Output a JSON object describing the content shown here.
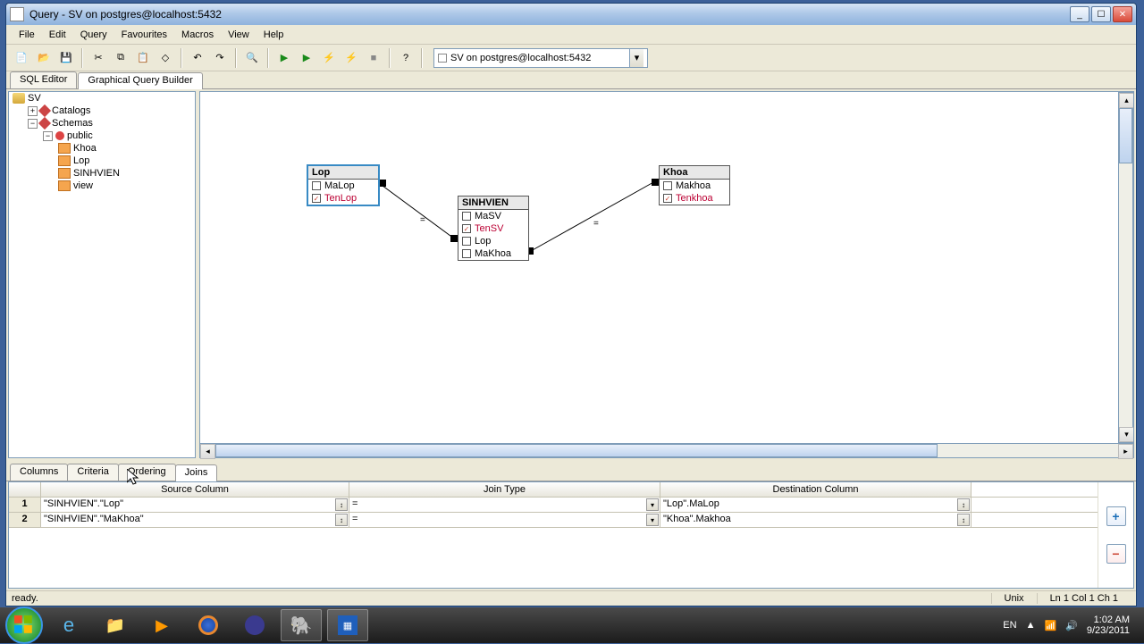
{
  "titlebar": {
    "title": "Query - SV on postgres@localhost:5432"
  },
  "menu": [
    "File",
    "Edit",
    "Query",
    "Favourites",
    "Macros",
    "View",
    "Help"
  ],
  "dbselect": "SV on postgres@localhost:5432",
  "view_tabs": {
    "sql": "SQL Editor",
    "gqb": "Graphical Query Builder"
  },
  "tree": {
    "root": "SV",
    "catalogs": "Catalogs",
    "schemas": "Schemas",
    "public": "public",
    "tables": [
      "Khoa",
      "Lop",
      "SINHVIEN",
      "view"
    ]
  },
  "boxes": {
    "Lop": {
      "title": "Lop",
      "cols": [
        {
          "name": "MaLop",
          "checked": false
        },
        {
          "name": "TenLop",
          "checked": true
        }
      ]
    },
    "SINHVIEN": {
      "title": "SINHVIEN",
      "cols": [
        {
          "name": "MaSV",
          "checked": false
        },
        {
          "name": "TenSV",
          "checked": true
        },
        {
          "name": "Lop",
          "checked": false
        },
        {
          "name": "MaKhoa",
          "checked": false
        }
      ]
    },
    "Khoa": {
      "title": "Khoa",
      "cols": [
        {
          "name": "Makhoa",
          "checked": false
        },
        {
          "name": "Tenkhoa",
          "checked": true
        }
      ]
    }
  },
  "conn_eq": "=",
  "bottom_tabs": {
    "columns": "Columns",
    "criteria": "Criteria",
    "ordering": "Ordering",
    "joins": "Joins"
  },
  "grid": {
    "headers": {
      "src": "Source Column",
      "jt": "Join Type",
      "dst": "Destination Column"
    },
    "rows": [
      {
        "n": "1",
        "src": "\"SINHVIEN\".\"Lop\"",
        "jt": "=",
        "dst": "\"Lop\".MaLop"
      },
      {
        "n": "2",
        "src": "\"SINHVIEN\".\"MaKhoa\"",
        "jt": "=",
        "dst": "\"Khoa\".Makhoa"
      }
    ]
  },
  "statusbar": {
    "left": "ready.",
    "unix": "Unix",
    "pos": "Ln 1 Col 1 Ch 1"
  },
  "tray": {
    "lang": "EN",
    "time": "1:02 AM",
    "date": "9/23/2011"
  }
}
